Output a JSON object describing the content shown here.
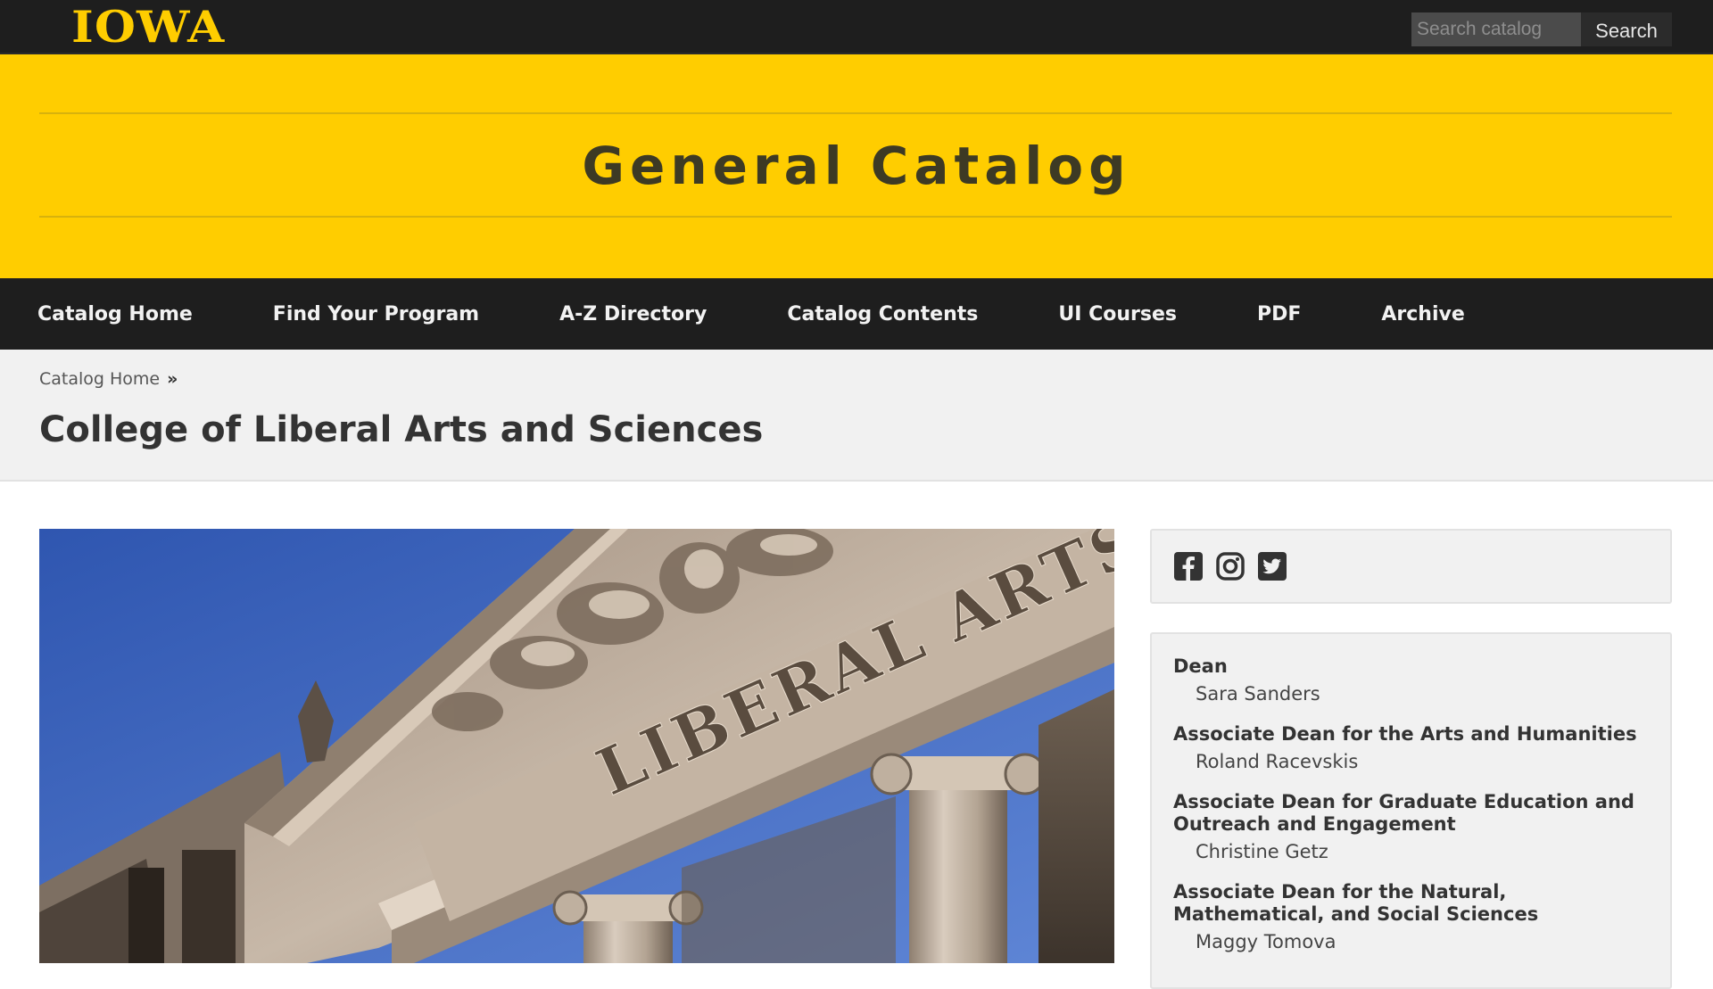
{
  "header": {
    "logo_text": "IOWA",
    "search": {
      "placeholder": "Search catalog",
      "button_label": "Search"
    }
  },
  "banner": {
    "title": "General Catalog"
  },
  "nav": {
    "items": [
      {
        "label": "Catalog Home"
      },
      {
        "label": "Find Your Program"
      },
      {
        "label": "A-Z Directory"
      },
      {
        "label": "Catalog Contents"
      },
      {
        "label": "UI Courses"
      },
      {
        "label": "PDF"
      },
      {
        "label": "Archive"
      }
    ]
  },
  "breadcrumb": {
    "items": [
      {
        "label": "Catalog Home"
      }
    ],
    "separator": "»"
  },
  "page": {
    "title": "College of Liberal Arts and Sciences"
  },
  "hero": {
    "inscription": "LIBERAL ARTS"
  },
  "sidebar": {
    "social": [
      {
        "icon": "facebook-icon"
      },
      {
        "icon": "instagram-icon"
      },
      {
        "icon": "twitter-icon"
      }
    ],
    "deans": [
      {
        "role": "Dean",
        "name": "Sara Sanders"
      },
      {
        "role": "Associate Dean for the Arts and Humanities",
        "name": "Roland Racevskis"
      },
      {
        "role": "Associate Dean for Graduate Education and Outreach and Engagement",
        "name": "Christine Getz"
      },
      {
        "role": "Associate Dean for the Natural, Mathematical, and Social Sciences",
        "name": "Maggy Tomova"
      }
    ]
  },
  "colors": {
    "brand_gold": "#ffcd00",
    "brand_black": "#1e1e1e",
    "panel_gray": "#f1f1f1",
    "sky_blue": "#3d67c2"
  }
}
